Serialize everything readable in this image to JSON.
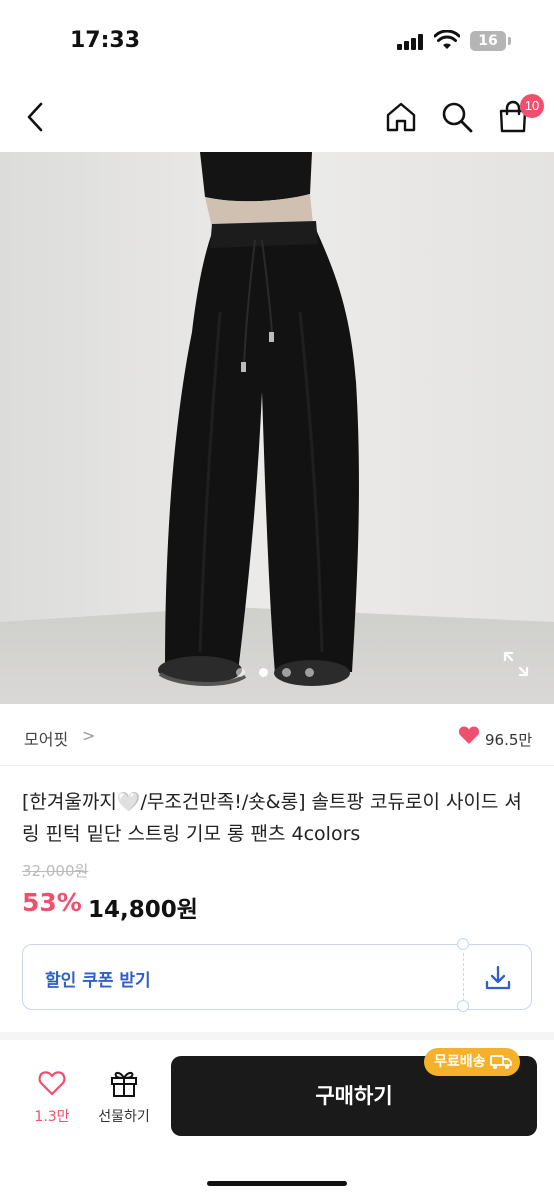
{
  "status_bar": {
    "time": "17:33",
    "battery": "16"
  },
  "header": {
    "cart_count": "10"
  },
  "colors": {
    "accent_pink": "#f0506e",
    "coupon_blue": "#2f5fc8",
    "free_shipping": "#f6b12a",
    "buy_button": "#1a1a1a"
  },
  "icons": {
    "back": "back-arrow-icon",
    "home": "home-icon",
    "search": "search-icon",
    "cart": "shopping-bag-icon",
    "expand": "expand-icon",
    "heart": "heart-icon",
    "gift": "gift-icon",
    "download": "download-icon",
    "truck": "truck-icon"
  },
  "gallery": {
    "slide_count": 4,
    "active_index": 1
  },
  "brand": {
    "name": "모어핏",
    "chevron": ">",
    "likes": "96.5만"
  },
  "product": {
    "title": "[한겨울까지🤍/무조건만족!/숏&롱] 솔트팡 코듀로이 사이드 셔링 핀턱 밑단 스트링 기모 롱 팬츠 4colors",
    "original_price": "32,000원",
    "discount_rate": "53%",
    "sale_price": "14,800원"
  },
  "coupon": {
    "label": "할인 쿠폰 받기"
  },
  "bottom_bar": {
    "like_count": "1.3만",
    "gift_label": "선물하기",
    "buy_label": "구매하기",
    "free_shipping_label": "무료배송"
  }
}
